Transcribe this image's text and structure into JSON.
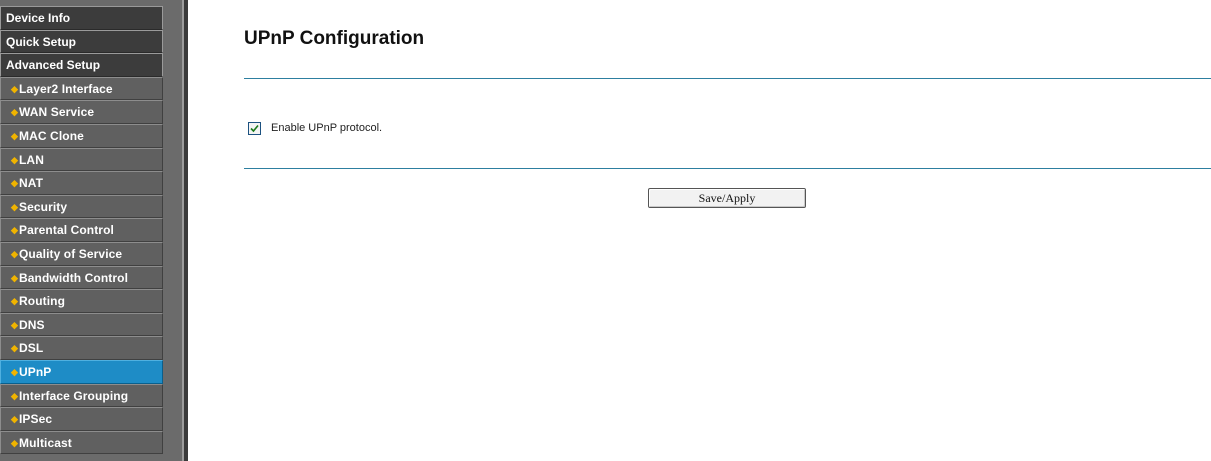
{
  "sidebar": {
    "items": [
      {
        "label": "Device Info",
        "level": "top",
        "active": false
      },
      {
        "label": "Quick Setup",
        "level": "top",
        "active": false
      },
      {
        "label": "Advanced Setup",
        "level": "top",
        "active": false
      },
      {
        "label": "Layer2 Interface",
        "level": "sub",
        "active": false
      },
      {
        "label": "WAN Service",
        "level": "sub",
        "active": false
      },
      {
        "label": "MAC Clone",
        "level": "sub",
        "active": false
      },
      {
        "label": "LAN",
        "level": "sub",
        "active": false
      },
      {
        "label": "NAT",
        "level": "sub",
        "active": false
      },
      {
        "label": "Security",
        "level": "sub",
        "active": false
      },
      {
        "label": "Parental Control",
        "level": "sub",
        "active": false
      },
      {
        "label": "Quality of Service",
        "level": "sub",
        "active": false
      },
      {
        "label": "Bandwidth Control",
        "level": "sub",
        "active": false
      },
      {
        "label": "Routing",
        "level": "sub",
        "active": false
      },
      {
        "label": "DNS",
        "level": "sub",
        "active": false
      },
      {
        "label": "DSL",
        "level": "sub",
        "active": false
      },
      {
        "label": "UPnP",
        "level": "sub",
        "active": true
      },
      {
        "label": "Interface Grouping",
        "level": "sub",
        "active": false
      },
      {
        "label": "IPSec",
        "level": "sub",
        "active": false
      },
      {
        "label": "Multicast",
        "level": "sub",
        "active": false
      }
    ],
    "bullet_icon": "diamond-bullet-icon",
    "colors": {
      "active": "#1e8cc6",
      "bullet": "#f0b400"
    }
  },
  "main": {
    "title": "UPnP Configuration",
    "option": {
      "label": "Enable UPnP protocol.",
      "checked": true,
      "icon": "checkmark-icon"
    },
    "save_label": "Save/Apply",
    "colors": {
      "rule": "#2d7fa0"
    }
  }
}
